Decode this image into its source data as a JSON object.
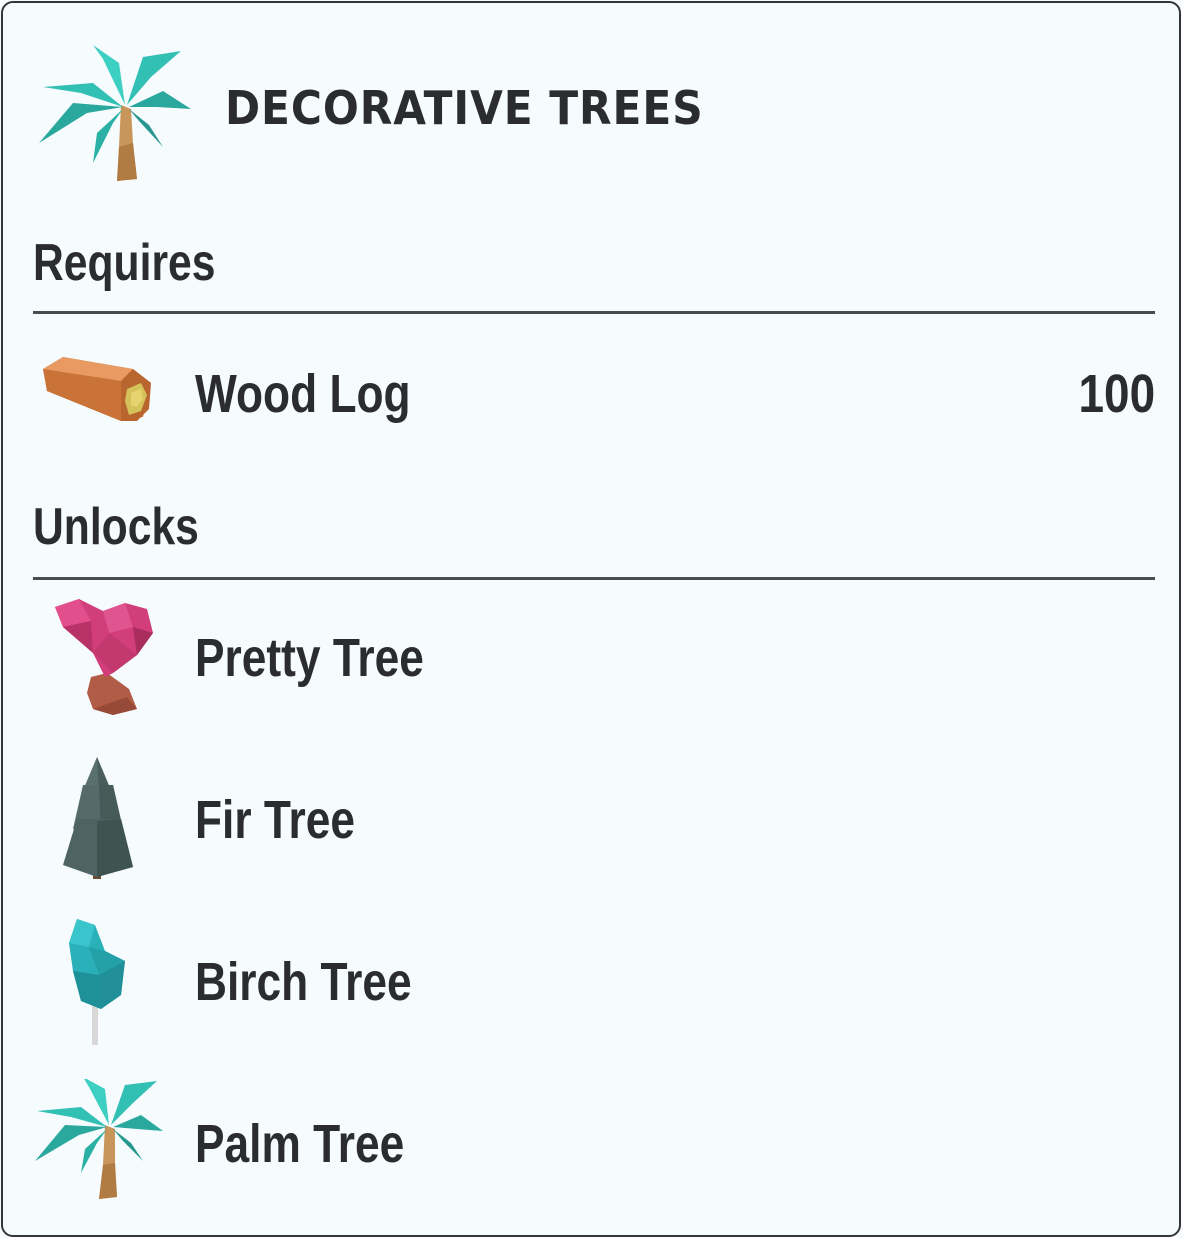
{
  "header": {
    "title": "DECORATIVE TREES",
    "icon": "palm-tree-icon"
  },
  "requires": {
    "heading": "Requires",
    "items": [
      {
        "label": "Wood Log",
        "amount": "100",
        "icon": "wood-log-icon"
      }
    ]
  },
  "unlocks": {
    "heading": "Unlocks",
    "items": [
      {
        "label": "Pretty Tree",
        "icon": "pretty-tree-icon"
      },
      {
        "label": "Fir Tree",
        "icon": "fir-tree-icon"
      },
      {
        "label": "Birch Tree",
        "icon": "birch-tree-icon"
      },
      {
        "label": "Palm Tree",
        "icon": "palm-tree-icon"
      }
    ]
  },
  "colors": {
    "background": "#f6fbfe",
    "text": "#2b2c2e",
    "border": "#333638",
    "palm_leaf": "#33c0b4",
    "trunk": "#c8955a",
    "pretty_leaf": "#d23e7a",
    "fir_leaf": "#4c615f",
    "birch_leaf": "#2ab0b8",
    "log": "#d9844c"
  }
}
